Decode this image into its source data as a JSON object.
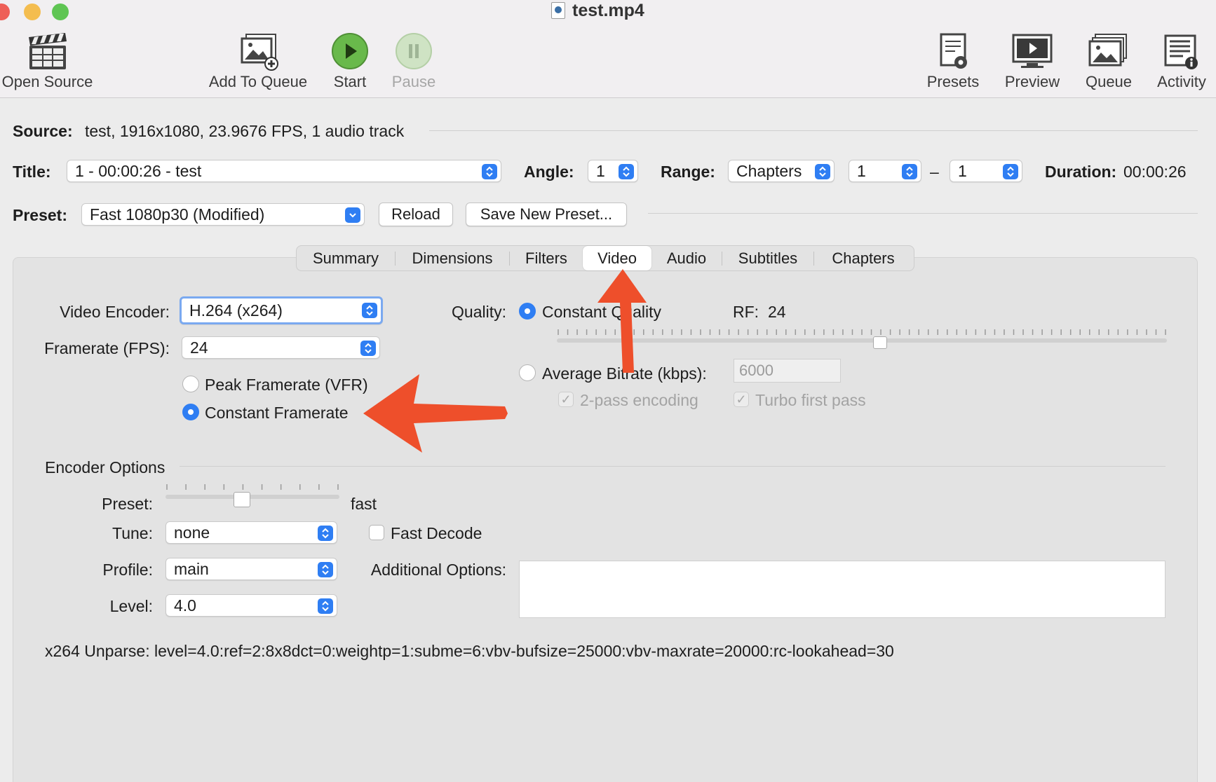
{
  "window": {
    "title": "test.mp4"
  },
  "toolbar": {
    "open_source": "Open Source",
    "add_to_queue": "Add To Queue",
    "start": "Start",
    "pause": "Pause",
    "presets": "Presets",
    "preview": "Preview",
    "queue": "Queue",
    "activity": "Activity"
  },
  "source": {
    "label": "Source:",
    "value": "test, 1916x1080, 23.9676 FPS, 1 audio track"
  },
  "title_row": {
    "title_label": "Title:",
    "title_value": "1 - 00:00:26 - test",
    "angle_label": "Angle:",
    "angle_value": "1",
    "range_label": "Range:",
    "range_type": "Chapters",
    "range_start": "1",
    "range_dash": "–",
    "range_end": "1",
    "duration_label": "Duration:",
    "duration_value": "00:00:26"
  },
  "preset_row": {
    "label": "Preset:",
    "value": "Fast 1080p30 (Modified)",
    "reload": "Reload",
    "save_new": "Save New Preset..."
  },
  "tabs": [
    "Summary",
    "Dimensions",
    "Filters",
    "Video",
    "Audio",
    "Subtitles",
    "Chapters"
  ],
  "active_tab": "Video",
  "video": {
    "encoder_label": "Video Encoder:",
    "encoder_value": "H.264 (x264)",
    "framerate_label": "Framerate (FPS):",
    "framerate_value": "24",
    "peak_framerate": "Peak Framerate (VFR)",
    "constant_framerate": "Constant Framerate",
    "framerate_mode": "Constant Framerate",
    "quality_label": "Quality:",
    "constant_quality": "Constant Quality",
    "rf_label": "RF:",
    "rf_value": "24",
    "quality_slider_fraction": 0.53,
    "average_bitrate": "Average Bitrate (kbps):",
    "bitrate_value": "6000",
    "two_pass": "2-pass encoding",
    "turbo_first_pass": "Turbo first pass"
  },
  "encoder_options": {
    "heading": "Encoder Options",
    "preset_label": "Preset:",
    "preset_value": "fast",
    "preset_slider_fraction": 0.44,
    "tune_label": "Tune:",
    "tune_value": "none",
    "fast_decode": "Fast Decode",
    "profile_label": "Profile:",
    "profile_value": "main",
    "additional_label": "Additional Options:",
    "additional_value": "",
    "level_label": "Level:",
    "level_value": "4.0",
    "unparse": "x264 Unparse: level=4.0:ref=2:8x8dct=0:weightp=1:subme=6:vbv-bufsize=25000:vbv-maxrate=20000:rc-lookahead=30"
  },
  "colors": {
    "accent": "#2f7ef3",
    "annotation_arrow": "#ee4f2b",
    "start_button": "#5db33c"
  }
}
